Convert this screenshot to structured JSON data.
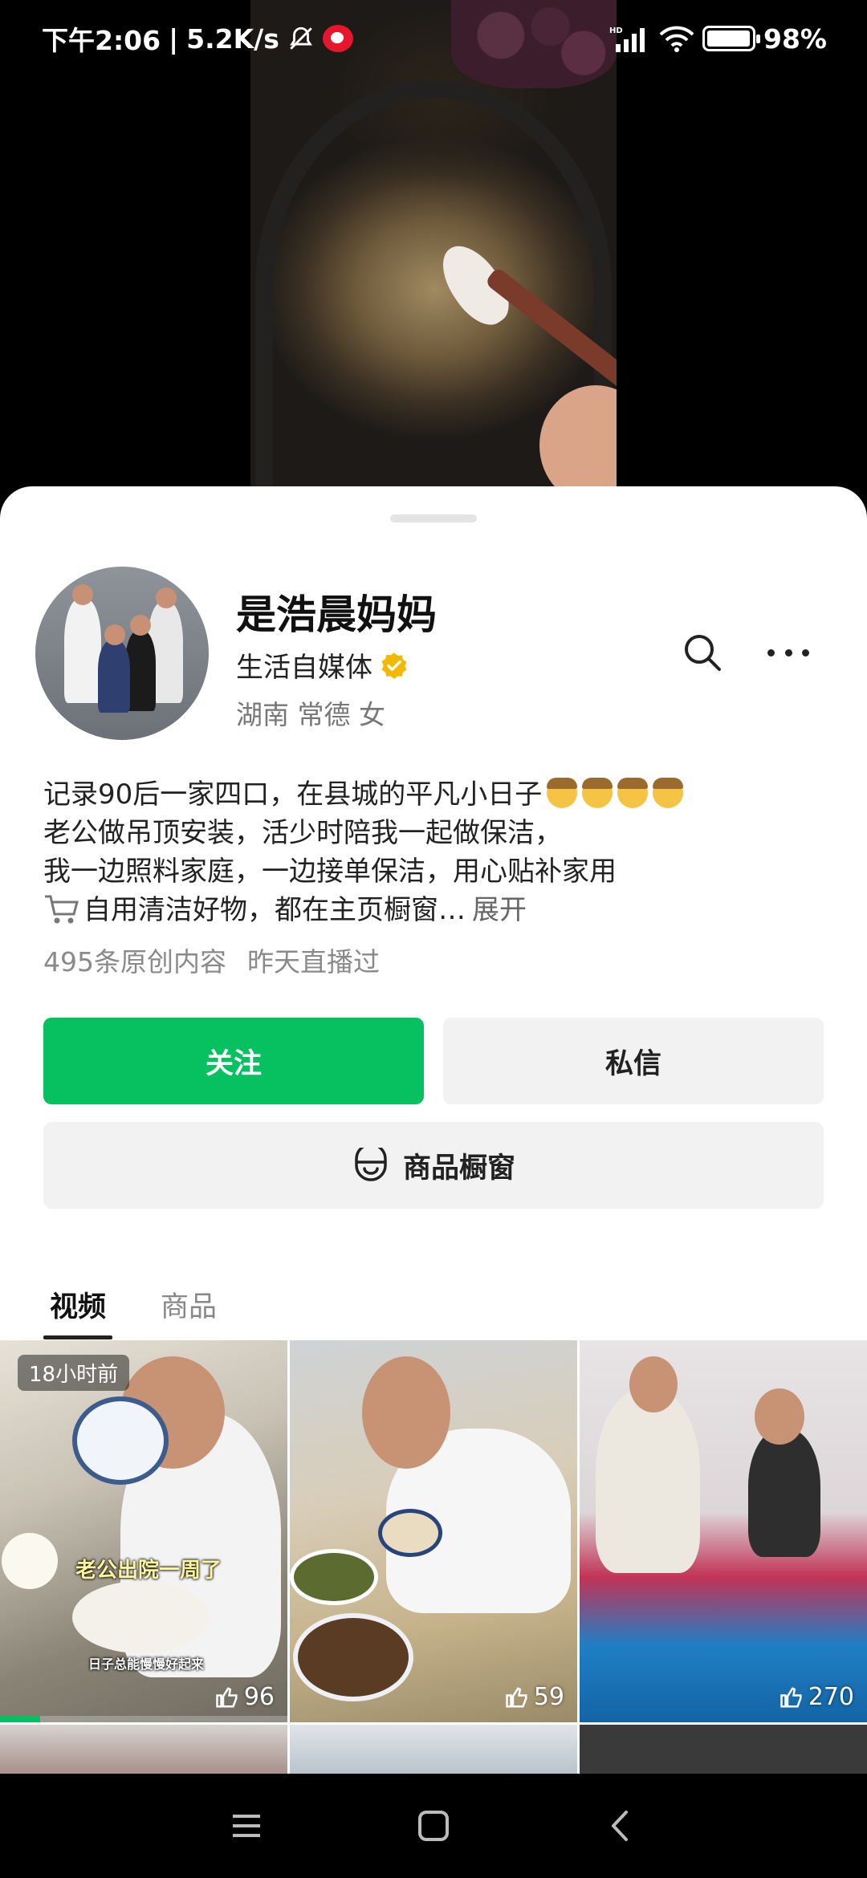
{
  "status_bar": {
    "time": "下午2:06",
    "net_speed": "5.2K/s",
    "battery": "98%",
    "battery_level": 0.98,
    "icons": [
      "bell-muted-icon",
      "weibo-icon",
      "signal-icon",
      "wifi-icon",
      "battery-icon"
    ]
  },
  "profile": {
    "name": "是浩晨妈妈",
    "tag": "生活自媒体",
    "location": "湖南 常德 女",
    "bio": [
      "记录90后一家四口，在县城的平凡小日子",
      "老公做吊顶安装，活少时陪我一起做保洁，",
      "我一边照料家庭，一边接单保洁，用心贴补家用",
      "自用清洁好物，都在主页橱窗…"
    ],
    "expand": "展开",
    "stats": {
      "posts": "495条原创内容",
      "live": "昨天直播过"
    }
  },
  "actions": {
    "follow": "关注",
    "message": "私信",
    "shop": "商品橱窗"
  },
  "tabs": [
    {
      "label": "视频",
      "active": true
    },
    {
      "label": "商品",
      "active": false
    }
  ],
  "videos": [
    {
      "time_badge": "18小时前",
      "caption_main": "老公出院一周了",
      "caption_sub": "日子总能慢慢好起来",
      "likes": "96",
      "progress": 0.14
    },
    {
      "likes": "59"
    },
    {
      "likes": "270"
    }
  ],
  "colors": {
    "accent": "#07c160",
    "verified": "#f5b800"
  }
}
